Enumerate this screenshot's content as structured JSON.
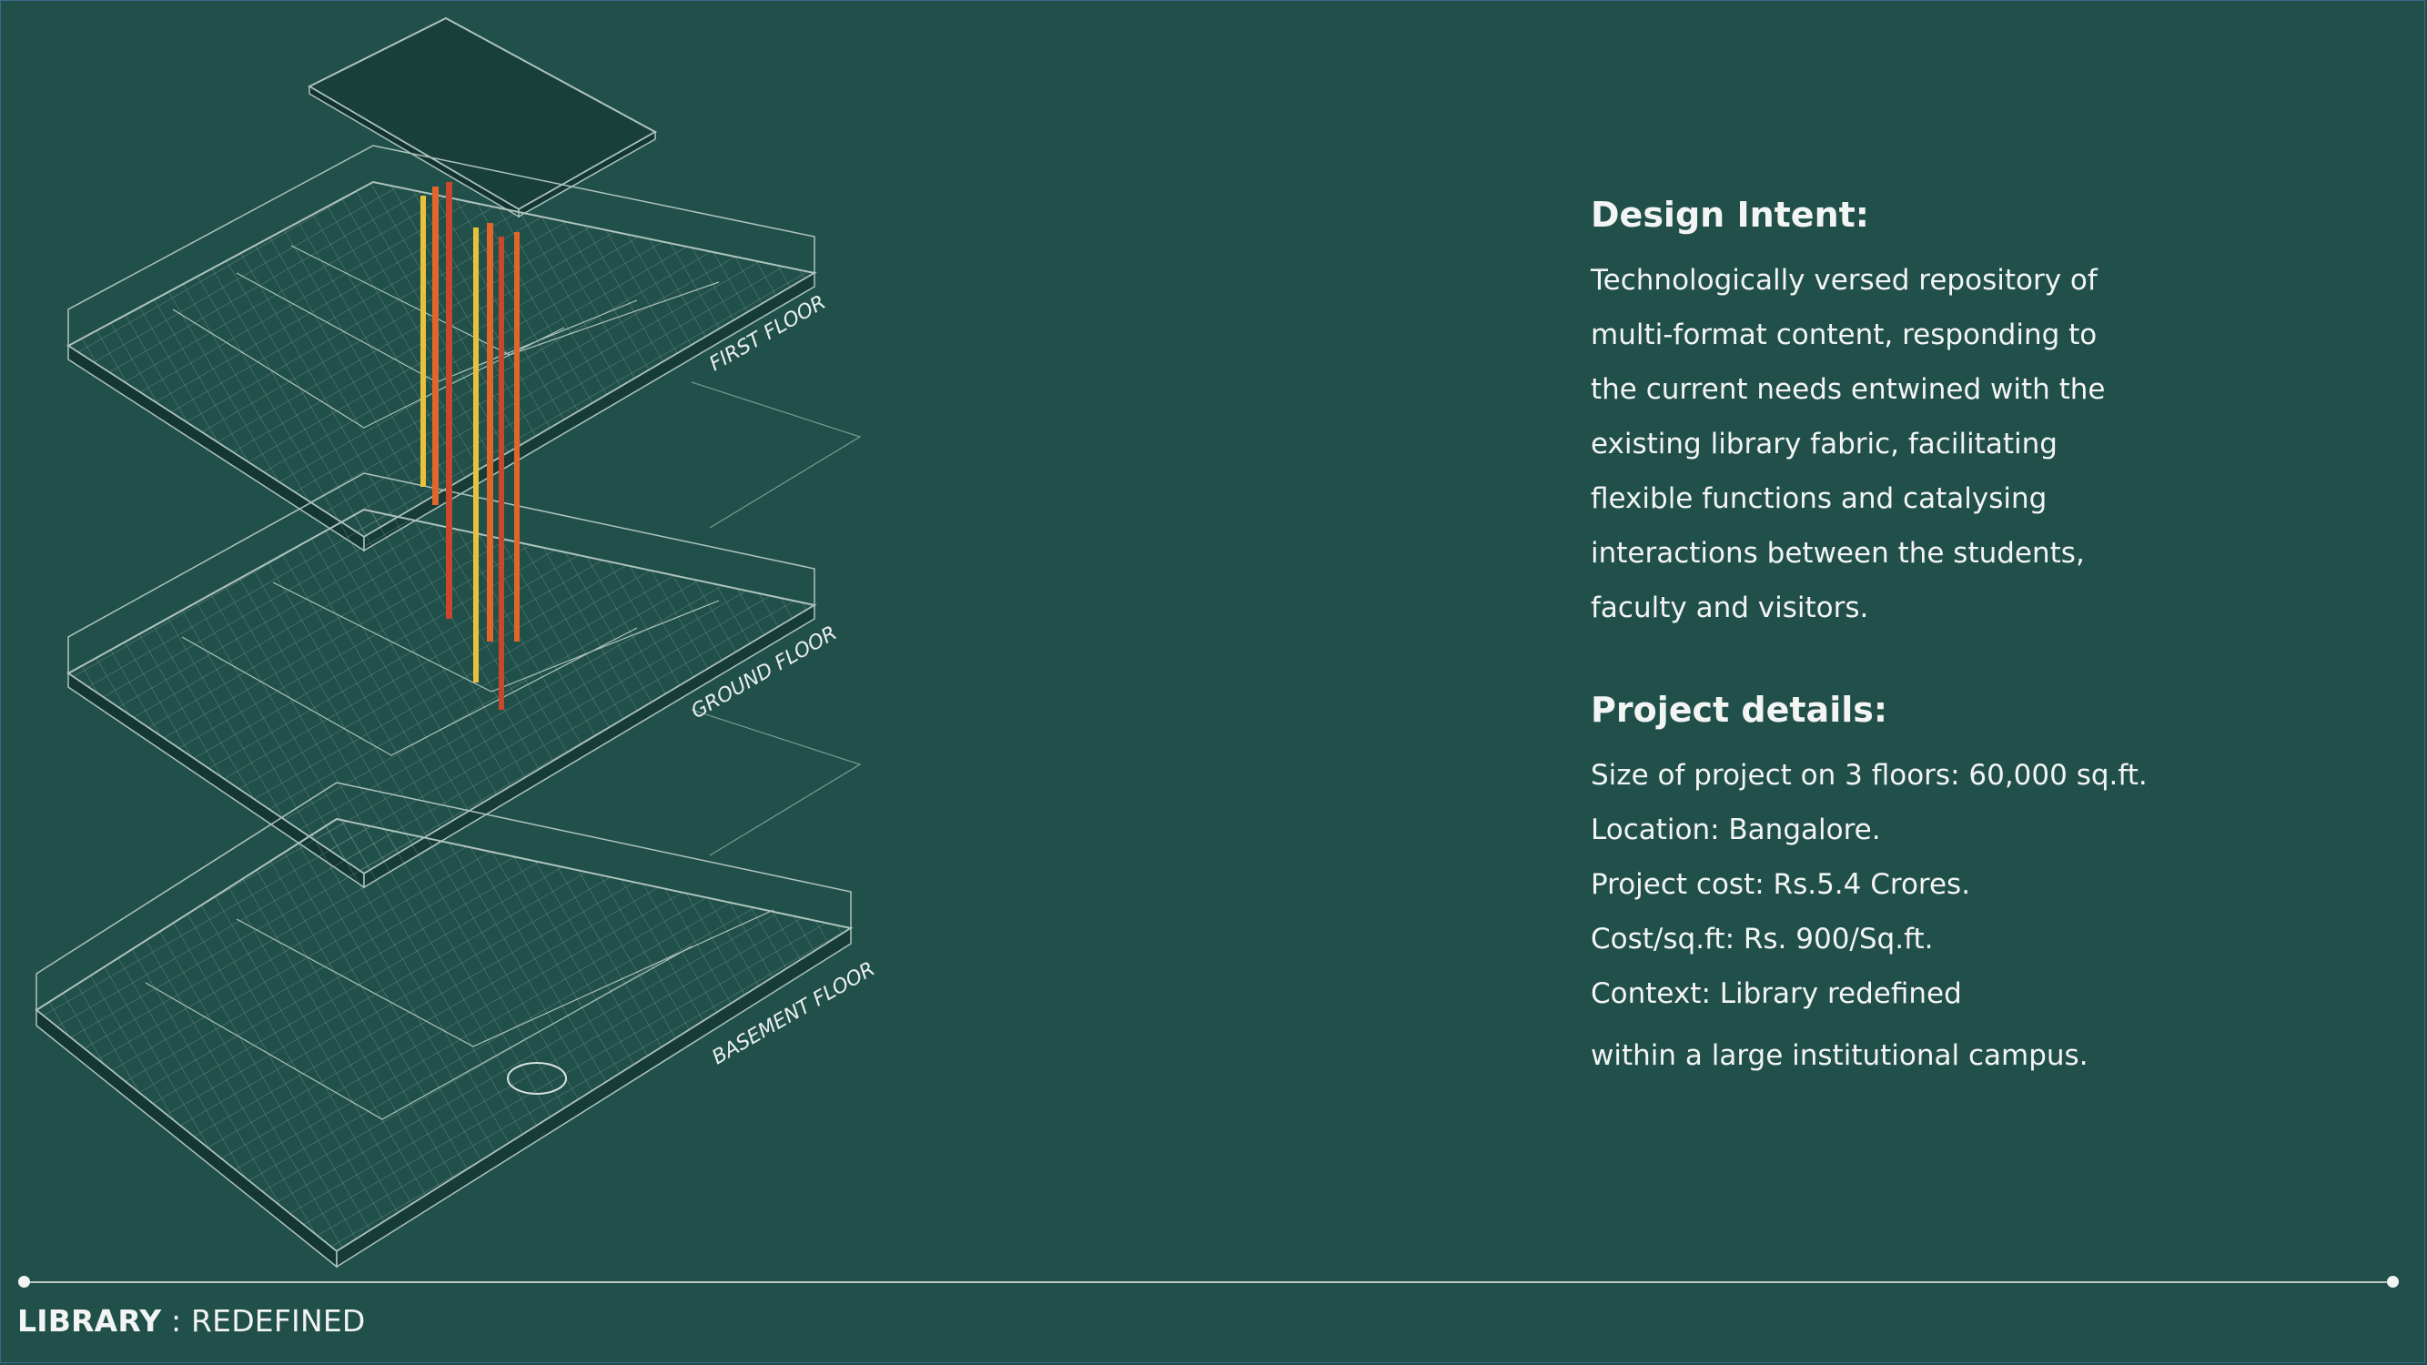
{
  "design_intent": {
    "heading": "Design Intent:",
    "lines": [
      "Technologically versed repository of",
      "multi-format content, responding to",
      "the current needs entwined with the",
      "existing library fabric, facilitating",
      "flexible functions and catalysing",
      "interactions between the students,",
      "faculty and visitors."
    ]
  },
  "project_details": {
    "heading": "Project details:",
    "lines": [
      "Size of project on 3 floors: 60,000 sq.ft.",
      "Location: Bangalore.",
      "Project cost: Rs.5.4 Crores.",
      "Cost/sq.ft: Rs. 900/Sq.ft.",
      "Context: Library redefined",
      "within a large institutional campus."
    ]
  },
  "drawing": {
    "floor_labels": [
      "FIRST FLOOR",
      "GROUND FLOOR",
      "BASEMENT FLOOR"
    ]
  },
  "footer": {
    "bold": "LIBRARY",
    "separator": " : ",
    "rest": "REDEFINED"
  },
  "colors": {
    "background": "#214f49",
    "text": "#f2f5f3",
    "linework": "#9fb8b1",
    "accent_orange": "#e0662a",
    "accent_yellow": "#e8c23a",
    "accent_red": "#c9472b"
  }
}
